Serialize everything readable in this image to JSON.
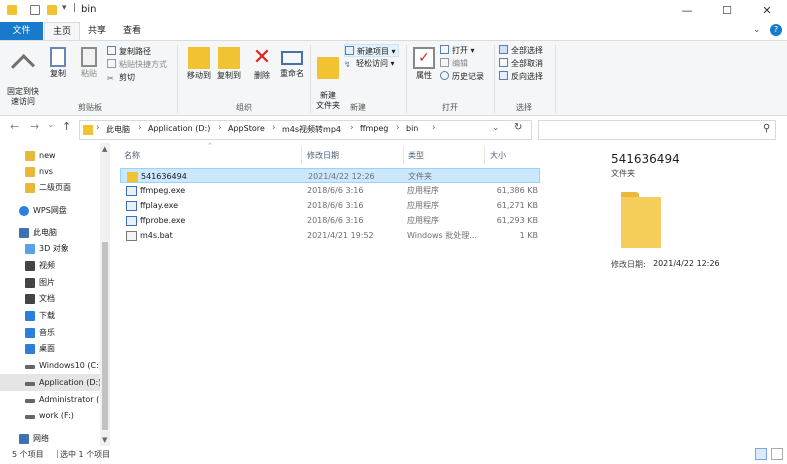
{
  "window": {
    "title": "bin",
    "minimize": "—",
    "maximize": "☐",
    "close": "✕"
  },
  "tabs": {
    "file": "文件",
    "home": "主页",
    "share": "共享",
    "view": "查看"
  },
  "ribbon": {
    "pin": "固定到快\n速访问",
    "copy": "复制",
    "paste": "粘贴",
    "copy_path": "复制路径",
    "paste_shortcut": "粘贴快捷方式",
    "cut": "剪切",
    "clipboard_group": "剪贴板",
    "move_to": "移动到",
    "copy_to": "复制到",
    "delete": "删除",
    "rename": "重命名",
    "organize_group": "组织",
    "new_folder": "新建\n文件夹",
    "new_item": "新建项目 ▾",
    "easy_access": "轻松访问 ▾",
    "new_group": "新建",
    "properties": "属性",
    "open": "打开 ▾",
    "edit": "编辑",
    "history": "历史记录",
    "open_group": "打开",
    "select_all": "全部选择",
    "select_none": "全部取消",
    "invert": "反向选择",
    "select_group": "选择",
    "help": "?"
  },
  "address": {
    "crumbs": [
      "此电脑",
      "Application (D:)",
      "AppStore",
      "m4s视频转mp4",
      "ffmpeg",
      "bin"
    ],
    "search_placeholder": ""
  },
  "nav": {
    "items": [
      {
        "label": "new",
        "color": "#e6b93a"
      },
      {
        "label": "nvs",
        "color": "#e6b93a"
      },
      {
        "label": "二级页面",
        "color": "#e6b93a"
      },
      {
        "label": "WPS网盘",
        "color": "#2f7de1"
      },
      {
        "label": "此电脑",
        "color": "#3f6fb5"
      },
      {
        "label": "3D 对象",
        "color": "#5aa0e6"
      },
      {
        "label": "视频",
        "color": "#444"
      },
      {
        "label": "图片",
        "color": "#444"
      },
      {
        "label": "文档",
        "color": "#444"
      },
      {
        "label": "下载",
        "color": "#2c7fd9"
      },
      {
        "label": "音乐",
        "color": "#2c7fd9"
      },
      {
        "label": "桌面",
        "color": "#2c7fd9"
      },
      {
        "label": "Windows10 (C:)",
        "color": "#666"
      },
      {
        "label": "Application (D:)",
        "color": "#666"
      },
      {
        "label": "Administrator (",
        "color": "#666"
      },
      {
        "label": "work (F:)",
        "color": "#666"
      },
      {
        "label": "网络",
        "color": "#3f6fb5"
      }
    ]
  },
  "columns": {
    "name": "名称",
    "date": "修改日期",
    "type": "类型",
    "size": "大小"
  },
  "files": [
    {
      "name": "541636494",
      "date": "2021/4/22 12:26",
      "type": "文件夹",
      "size": "",
      "icon": "folder"
    },
    {
      "name": "ffmpeg.exe",
      "date": "2018/6/6 3:16",
      "type": "应用程序",
      "size": "61,386 KB",
      "icon": "exe"
    },
    {
      "name": "ffplay.exe",
      "date": "2018/6/6 3:16",
      "type": "应用程序",
      "size": "61,271 KB",
      "icon": "exe"
    },
    {
      "name": "ffprobe.exe",
      "date": "2018/6/6 3:16",
      "type": "应用程序",
      "size": "61,293 KB",
      "icon": "exe"
    },
    {
      "name": "m4s.bat",
      "date": "2021/4/21 19:52",
      "type": "Windows 批处理...",
      "size": "1 KB",
      "icon": "bat"
    }
  ],
  "details": {
    "name": "541636494",
    "type": "文件夹",
    "date_label": "修改日期:",
    "date_value": "2021/4/22 12:26"
  },
  "status": {
    "count": "5 个项目",
    "selected": "选中 1 个项目"
  }
}
